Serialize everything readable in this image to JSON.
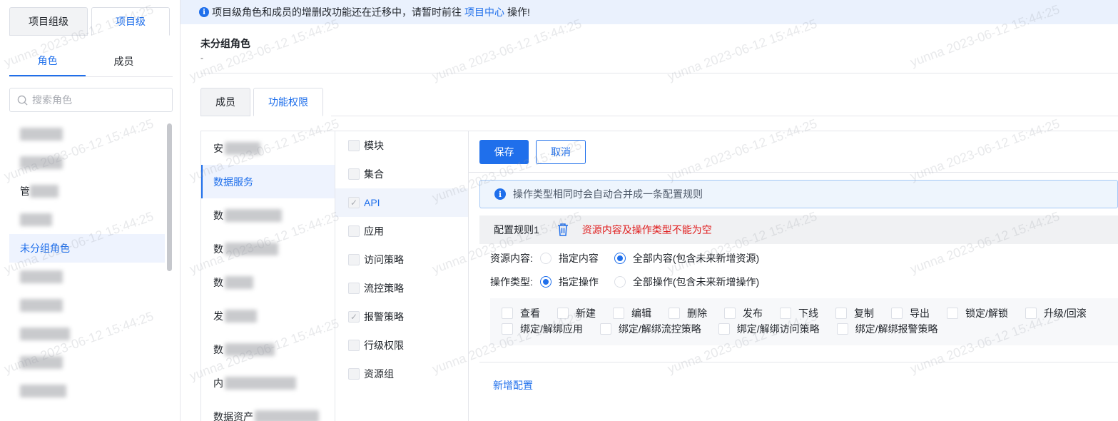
{
  "sidebar": {
    "level_tabs": [
      "项目组级",
      "项目级"
    ],
    "role_tabs": [
      "角色",
      "成员"
    ],
    "search_placeholder": "搜索角色",
    "roles": [
      {
        "label": "",
        "blur_w": 60
      },
      {
        "label": "",
        "blur_w": 60
      },
      {
        "label": "管",
        "blur_w": 40
      },
      {
        "label": "",
        "blur_w": 45
      },
      {
        "label": "未分组角色",
        "blur_w": 0
      },
      {
        "label": "",
        "blur_w": 60
      },
      {
        "label": "",
        "blur_w": 60
      },
      {
        "label": "",
        "blur_w": 70
      },
      {
        "label": "",
        "blur_w": 60
      },
      {
        "label": "",
        "blur_w": 65
      }
    ]
  },
  "notice": {
    "text_before": "项目级角色和成员的增删改功能还在迁移中，请暂时前往",
    "link": "项目中心",
    "text_after": "操作!"
  },
  "role": {
    "title": "未分组角色",
    "description": "-"
  },
  "main_tabs": [
    "成员",
    "功能权限"
  ],
  "services": [
    {
      "label": "安",
      "blur_w": 50
    },
    {
      "label": "数据服务",
      "blur_w": 0
    },
    {
      "label": "数",
      "blur_w": 80
    },
    {
      "label": "数",
      "blur_w": 75
    },
    {
      "label": "数",
      "blur_w": 40
    },
    {
      "label": "发",
      "blur_w": 45
    },
    {
      "label": "数",
      "blur_w": 70
    },
    {
      "label": "内",
      "blur_w": 100
    },
    {
      "label": "数据资产",
      "blur_w": 90
    }
  ],
  "modules": [
    "模块",
    "集合",
    "API",
    "应用",
    "访问策略",
    "流控策略",
    "报警策略",
    "行级权限",
    "资源组"
  ],
  "config": {
    "save": "保存",
    "cancel": "取消",
    "alert": "操作类型相同时会自动合并成一条配置规则",
    "rule_title": "配置规则1",
    "rule_error": "资源内容及操作类型不能为空",
    "resource_label": "资源内容:",
    "resource_opt1": "指定内容",
    "resource_opt2": "全部内容(包含未来新增资源)",
    "op_label": "操作类型:",
    "op_opt1": "指定操作",
    "op_opt2": "全部操作(包含未来新增操作)",
    "ops_row1": [
      "查看",
      "新建",
      "编辑",
      "删除",
      "发布",
      "下线",
      "复制",
      "导出",
      "锁定/解锁",
      "升级/回滚"
    ],
    "ops_row2": [
      "绑定/解绑应用",
      "绑定/解绑流控策略",
      "绑定/解绑访问策略",
      "绑定/解绑报警策略"
    ],
    "add": "新增配置"
  },
  "colors": {
    "primary": "#1f6feb",
    "error": "#e02020"
  }
}
